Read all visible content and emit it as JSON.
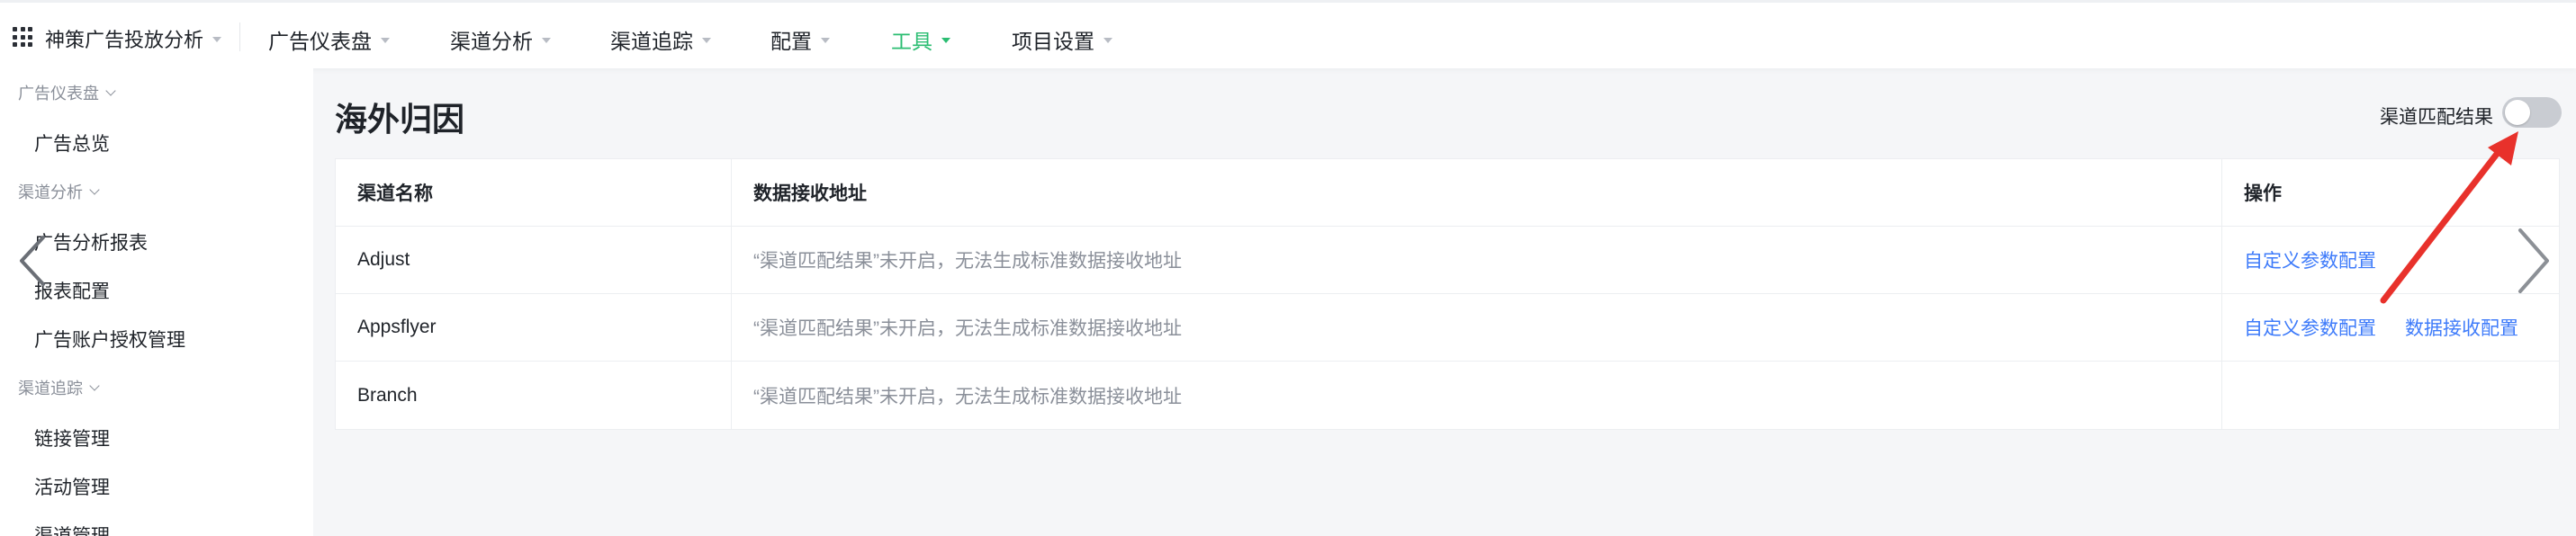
{
  "app": {
    "name": "神策广告投放分析"
  },
  "topnav": {
    "items": [
      {
        "label": "广告仪表盘",
        "active": false
      },
      {
        "label": "渠道分析",
        "active": false
      },
      {
        "label": "渠道追踪",
        "active": false
      },
      {
        "label": "配置",
        "active": false
      },
      {
        "label": "工具",
        "active": true
      },
      {
        "label": "项目设置",
        "active": false
      }
    ]
  },
  "sidebar": {
    "groups": [
      {
        "label": "广告仪表盘",
        "items": [
          "广告总览"
        ]
      },
      {
        "label": "渠道分析",
        "items": [
          "广告分析报表",
          "报表配置",
          "广告账户授权管理"
        ]
      },
      {
        "label": "渠道追踪",
        "items": [
          "链接管理",
          "活动管理",
          "渠道管理"
        ]
      }
    ]
  },
  "page": {
    "title": "海外归因",
    "toggle": {
      "label": "渠道匹配结果",
      "on": false
    }
  },
  "table": {
    "headers": [
      "渠道名称",
      "数据接收地址",
      "操作"
    ],
    "rows": [
      {
        "name": "Adjust",
        "address": "“渠道匹配结果”未开启，无法生成标准数据接收地址",
        "actions": [
          "自定义参数配置"
        ]
      },
      {
        "name": "Appsflyer",
        "address": "“渠道匹配结果”未开启，无法生成标准数据接收地址",
        "actions": [
          "自定义参数配置",
          "数据接收配置"
        ]
      },
      {
        "name": "Branch",
        "address": "“渠道匹配结果”未开启，无法生成标准数据接收地址",
        "actions": []
      }
    ]
  },
  "icons": {
    "apps": "grid-icon",
    "prev": "chevron-left-icon",
    "next": "chevron-right-icon",
    "annotation": "red-arrow-annotation"
  },
  "colors": {
    "accent": "#2bbd72",
    "link": "#3e7bfa",
    "annotation": "#e8312b",
    "muted": "#8a8f99"
  }
}
